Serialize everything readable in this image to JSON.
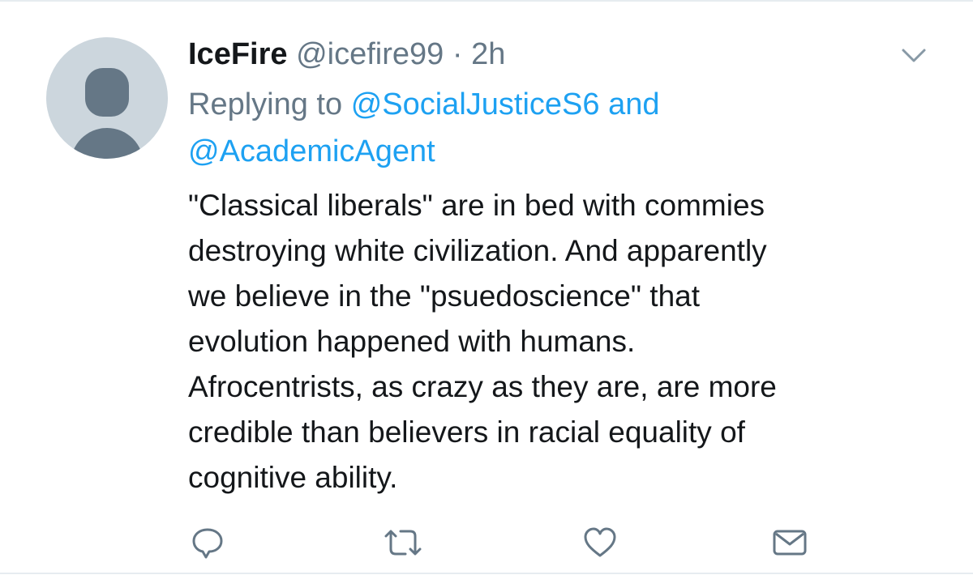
{
  "tweet": {
    "display_name": "IceFire",
    "handle": "@icefire99",
    "separator": "·",
    "time": "2h",
    "replying": {
      "prefix": "Replying to",
      "mention_1": "@SocialJusticeS6",
      "conjunction": "and",
      "mention_2": "@AcademicAgent"
    },
    "text": "\"Classical liberals\" are in bed with commies\ndestroying white civilization. And apparently\nwe believe in the \"psuedoscience\" that\nevolution happened with humans.\nAfrocentrists, as crazy as they are, are more\ncredible than believers in racial equality of\ncognitive ability."
  },
  "icons": {
    "avatar": "default-avatar",
    "menu": "chevron-down-icon",
    "reply": "reply-icon",
    "retweet": "retweet-icon",
    "like": "heart-icon",
    "message": "envelope-icon"
  },
  "colors": {
    "link": "#1da1f2",
    "secondary_text": "#657786",
    "primary_text": "#14171a",
    "avatar_bg": "#ccd6dd",
    "divider": "#e6ecf0"
  }
}
